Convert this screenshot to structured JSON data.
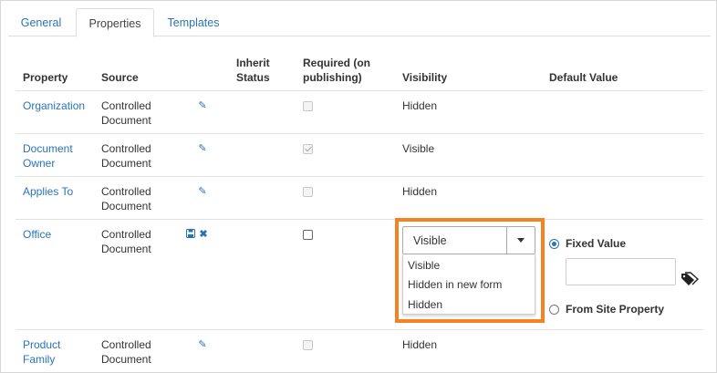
{
  "tabs": [
    {
      "label": "General",
      "active": false
    },
    {
      "label": "Properties",
      "active": true
    },
    {
      "label": "Templates",
      "active": false
    }
  ],
  "columns": {
    "property": "Property",
    "source": "Source",
    "inherit": "Inherit Status",
    "required": "Required (on publishing)",
    "visibility": "Visibility",
    "default": "Default Value"
  },
  "rows": [
    {
      "property": "Organization",
      "source": "Controlled Document",
      "required_checked": false,
      "visibility": "Hidden"
    },
    {
      "property": "Document Owner",
      "source": "Controlled Document",
      "required_checked": true,
      "visibility": "Visible"
    },
    {
      "property": "Applies To",
      "source": "Controlled Document",
      "required_checked": false,
      "visibility": "Hidden"
    },
    {
      "property": "Office",
      "source": "Controlled Document",
      "required_checked": false,
      "visibility": "Visible",
      "editing": true
    },
    {
      "property": "Product Family",
      "source": "Controlled Document",
      "required_checked": false,
      "visibility": "Hidden"
    }
  ],
  "visibility_select": {
    "value": "Visible",
    "options": [
      "Visible",
      "Hidden in new form",
      "Hidden"
    ]
  },
  "default_value": {
    "fixed_label": "Fixed Value",
    "site_label": "From Site Property",
    "selected": "fixed",
    "fixed_value": ""
  },
  "icons": {
    "edit": "edit-icon",
    "save": "save-icon",
    "cancel": "cancel-icon",
    "tag": "tag-icon"
  },
  "colors": {
    "link": "#2a73b8",
    "highlight": "#f58220"
  }
}
